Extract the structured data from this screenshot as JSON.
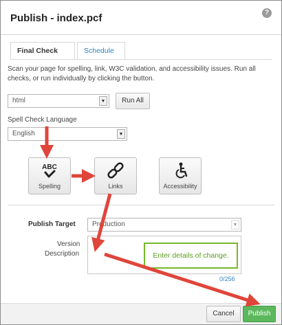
{
  "dialog": {
    "title": "Publish - index.pcf",
    "help_icon": "?"
  },
  "tabs": [
    {
      "label": "Final Check",
      "active": true
    },
    {
      "label": "Schedule",
      "active": false
    }
  ],
  "description": "Scan your page for spelling, link, W3C validation, and accessibility issues. Run all checks, or run individually by clicking the button.",
  "validator": {
    "selected": "html",
    "run_all_label": "Run All"
  },
  "spell_check": {
    "label": "Spell Check Language",
    "selected": "English"
  },
  "checks": [
    {
      "label": "Spelling",
      "icon": "spelling-abc-check-icon"
    },
    {
      "label": "Links",
      "icon": "link-chain-icon"
    },
    {
      "label": "Accessibility",
      "icon": "accessibility-wheelchair-icon"
    }
  ],
  "publish_target": {
    "label": "Publish Target",
    "selected": "Production"
  },
  "version_description": {
    "label_line1": "Version",
    "label_line2": "Description",
    "hint": "Enter details of change.",
    "counter": "0/256"
  },
  "footer": {
    "cancel_label": "Cancel",
    "publish_label": "Publish"
  },
  "colors": {
    "link_blue": "#2e84c6",
    "publish_green": "#5cb85c",
    "annotation_red": "#e0453a",
    "hint_green": "#76b82a"
  }
}
